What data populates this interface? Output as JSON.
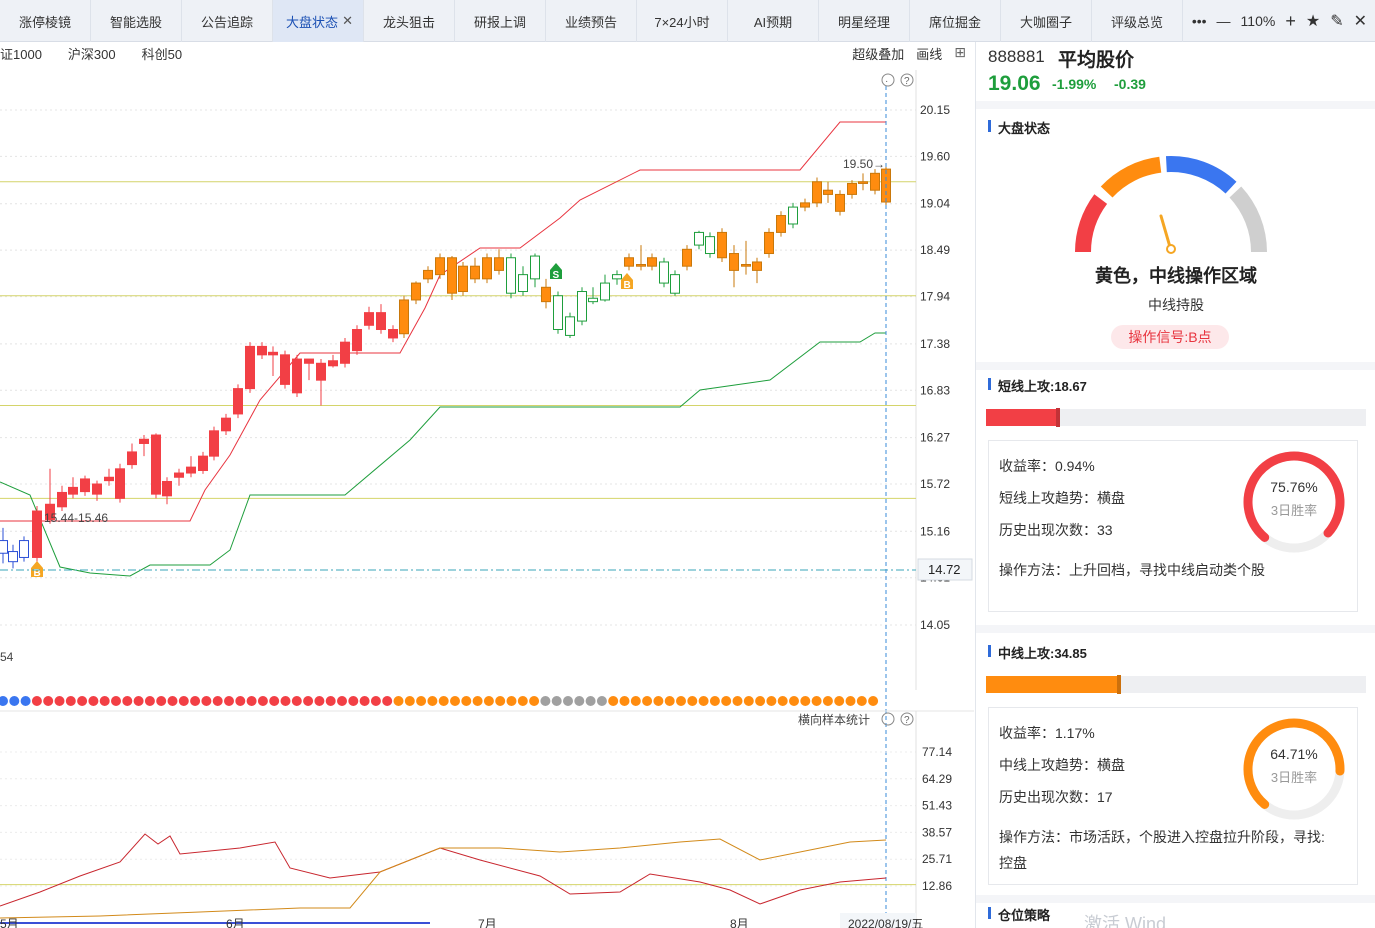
{
  "tabs": [
    {
      "label": "涨停棱镜"
    },
    {
      "label": "智能选股"
    },
    {
      "label": "公告追踪"
    },
    {
      "label": "大盘状态",
      "active": true
    },
    {
      "label": "龙头狙击"
    },
    {
      "label": "研报上调"
    },
    {
      "label": "业绩预告"
    },
    {
      "label": "7×24小时"
    },
    {
      "label": "AI预期"
    },
    {
      "label": "明星经理"
    },
    {
      "label": "席位掘金"
    },
    {
      "label": "大咖圈子"
    },
    {
      "label": "评级总览"
    }
  ],
  "toolbar": {
    "more": "•••",
    "zoom_out": "—",
    "zoom": "110%",
    "zoom_in": "+",
    "star": "★",
    "pen": "✎",
    "close": "✕",
    "tab_close": "✕"
  },
  "index_row": [
    "证1000",
    "沪深300",
    "科创50"
  ],
  "chart_tools": {
    "overlay": "超级叠加",
    "draw": "画线",
    "grid_icon": "grid-icon"
  },
  "price_axis": [
    "20.15",
    "19.60",
    "19.04",
    "18.49",
    "17.94",
    "17.38",
    "16.83",
    "16.27",
    "15.72",
    "15.16",
    "14.61",
    "14.05"
  ],
  "price_cursor_label": "14.72",
  "annotations": {
    "range_label": "15.44-15.46",
    "high_label": "19.50→",
    "left_value": "54",
    "buy_marker": "B",
    "sell_marker": "S"
  },
  "lower_panel": {
    "title": "横向样本统计",
    "axis": [
      "77.14",
      "64.29",
      "51.43",
      "38.57",
      "25.71",
      "12.86"
    ]
  },
  "x_axis": [
    "5月",
    "6月",
    "7月",
    "8月"
  ],
  "date_label": "2022/08/19/五",
  "stock": {
    "code": "888881",
    "name": "平均股价",
    "price": "19.06",
    "pct": "-1.99%",
    "change": "-0.39"
  },
  "market": {
    "title": "大盘状态",
    "status": "黄色，中线操作区域",
    "sub": "中线持股",
    "signal": "操作信号:B点",
    "gauge_colors": [
      "#f23f45",
      "#ff8c0f",
      "#3a76f0",
      "#cfcfcf"
    ]
  },
  "short_attack": {
    "title": "短线上攻:18.67",
    "fill_fraction": 0.19,
    "color": "#f23f45",
    "yield": "收益率：0.94%",
    "trend": "短线上攻趋势：横盘",
    "count": "历史出现次数：33",
    "method": "操作方法：上升回档，寻找中线启动类个股",
    "win_rate": 0.7576,
    "win_rate_text": "75.76%",
    "win_label": "3日胜率"
  },
  "mid_attack": {
    "title": "中线上攻:34.85",
    "fill_fraction": 0.35,
    "color": "#ff8c0f",
    "yield": "收益率：1.17%",
    "trend": "中线上攻趋势：横盘",
    "count": "历史出现次数：17",
    "method": "操作方法：市场活跃，个股进入控盘拉升阶段，寻找:",
    "method2": "控盘",
    "win_rate": 0.6471,
    "win_rate_text": "64.71%",
    "win_label": "3日胜率"
  },
  "position": {
    "title": "仓位策略"
  },
  "watermark": "激活 Wind",
  "colors": {
    "up": "#f23f45",
    "down_green": "#1e9e3c",
    "orange": "#ff8c0f",
    "grey": "#a0a0a0",
    "blue": "#3a76f0",
    "hline": "#d4d46a"
  }
}
